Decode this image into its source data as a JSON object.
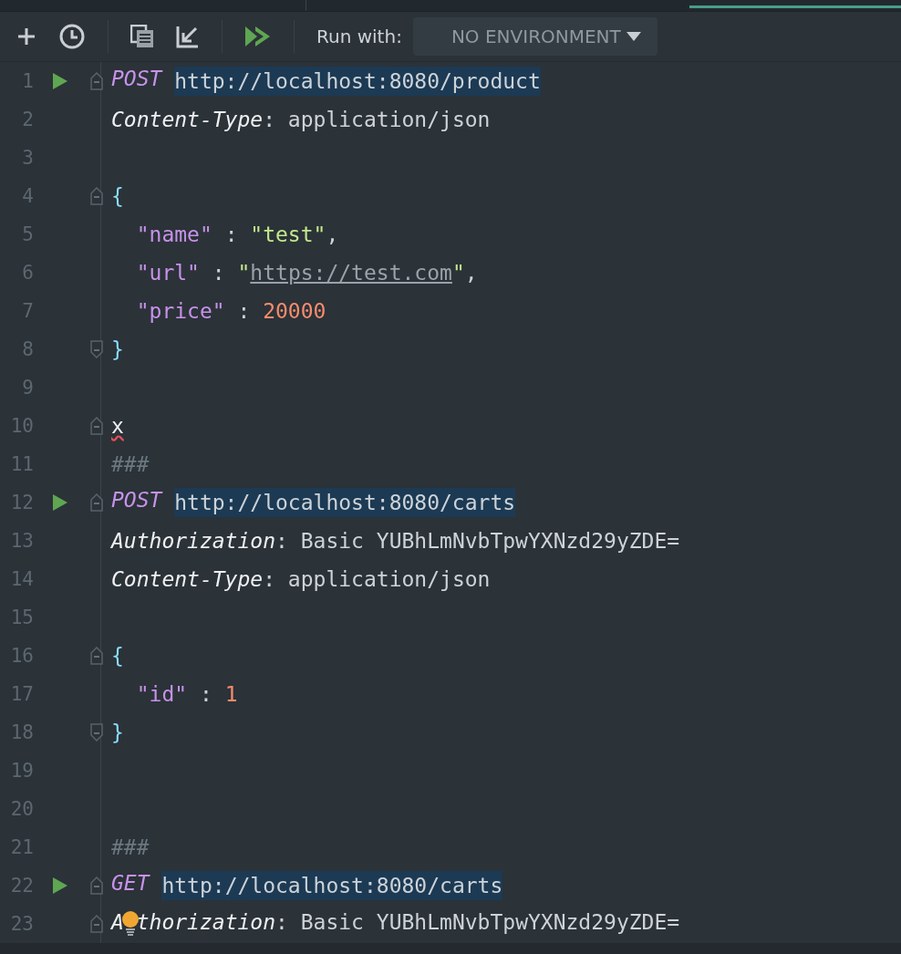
{
  "toolbar": {
    "run_with_label": "Run with:",
    "environment": "NO ENVIRONMENT"
  },
  "lines": [
    {
      "number": "1",
      "run": true,
      "fold_start": true,
      "tokens": [
        {
          "kind": "method",
          "text": "POST"
        },
        {
          "kind": "url",
          "text": "http://localhost:8080/product"
        }
      ]
    },
    {
      "number": "2",
      "tokens": [
        {
          "kind": "header",
          "text": "Content-Type"
        },
        {
          "kind": "plain",
          "text": ": application/json"
        }
      ]
    },
    {
      "number": "3"
    },
    {
      "number": "4",
      "fold_start": true,
      "tokens": [
        {
          "kind": "brace",
          "text": "{"
        }
      ]
    },
    {
      "number": "5",
      "indented": true,
      "tokens": [
        {
          "kind": "key",
          "text": "\"name\""
        },
        {
          "kind": "plain",
          "text": " : "
        },
        {
          "kind": "string",
          "text": "\"test\""
        },
        {
          "kind": "plain",
          "text": ","
        }
      ]
    },
    {
      "number": "6",
      "indented": true,
      "tokens": [
        {
          "kind": "key",
          "text": "\"url\""
        },
        {
          "kind": "plain",
          "text": " : "
        },
        {
          "kind": "string",
          "text": "\""
        },
        {
          "kind": "link",
          "text": "https://test.com"
        },
        {
          "kind": "string",
          "text": "\""
        },
        {
          "kind": "plain",
          "text": ","
        }
      ]
    },
    {
      "number": "7",
      "indented": true,
      "tokens": [
        {
          "kind": "key",
          "text": "\"price\""
        },
        {
          "kind": "plain",
          "text": " : "
        },
        {
          "kind": "number",
          "text": "20000"
        }
      ]
    },
    {
      "number": "8",
      "fold_end": true,
      "tokens": [
        {
          "kind": "brace",
          "text": "}"
        }
      ]
    },
    {
      "number": "9"
    },
    {
      "number": "10",
      "fold_start": true,
      "tokens": [
        {
          "kind": "error",
          "text": "x"
        }
      ]
    },
    {
      "number": "11",
      "tokens": [
        {
          "kind": "comment",
          "text": "###"
        }
      ]
    },
    {
      "number": "12",
      "run": true,
      "fold_start": true,
      "tokens": [
        {
          "kind": "method",
          "text": "POST"
        },
        {
          "kind": "url",
          "text": "http://localhost:8080/carts"
        }
      ]
    },
    {
      "number": "13",
      "tokens": [
        {
          "kind": "header",
          "text": "Authorization"
        },
        {
          "kind": "plain",
          "text": ": Basic YUBhLmNvbTpwYXNzd29yZDE="
        }
      ]
    },
    {
      "number": "14",
      "tokens": [
        {
          "kind": "header",
          "text": "Content-Type"
        },
        {
          "kind": "plain",
          "text": ": application/json"
        }
      ]
    },
    {
      "number": "15"
    },
    {
      "number": "16",
      "fold_start": true,
      "tokens": [
        {
          "kind": "brace",
          "text": "{"
        }
      ]
    },
    {
      "number": "17",
      "indented": true,
      "tokens": [
        {
          "kind": "key",
          "text": "\"id\""
        },
        {
          "kind": "plain",
          "text": " : "
        },
        {
          "kind": "number",
          "text": "1"
        }
      ]
    },
    {
      "number": "18",
      "fold_end": true,
      "tokens": [
        {
          "kind": "brace",
          "text": "}"
        }
      ]
    },
    {
      "number": "19"
    },
    {
      "number": "20"
    },
    {
      "number": "21",
      "tokens": [
        {
          "kind": "comment",
          "text": "###"
        }
      ]
    },
    {
      "number": "22",
      "run": true,
      "fold_start": true,
      "tokens": [
        {
          "kind": "method",
          "text": "GET"
        },
        {
          "kind": "url",
          "text": "http://localhost:8080/carts"
        }
      ]
    },
    {
      "number": "23",
      "fold_start": true,
      "tokens": [
        {
          "kind": "header",
          "text": "A"
        },
        {
          "kind": "bulb"
        },
        {
          "kind": "header",
          "text": "thorization"
        },
        {
          "kind": "plain",
          "text": ": Basic YUBhLmNvbTpwYXNzd29yZDE="
        }
      ]
    }
  ]
}
